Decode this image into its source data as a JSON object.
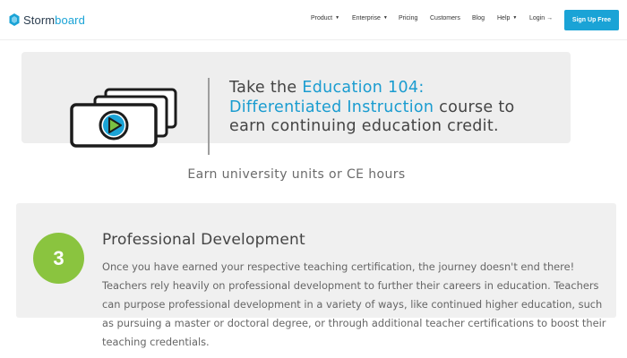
{
  "header": {
    "logo_prefix": "Storm",
    "logo_suffix": "board",
    "nav": [
      {
        "label": "Product",
        "dropdown": true
      },
      {
        "label": "Enterprise",
        "dropdown": true
      },
      {
        "label": "Pricing",
        "dropdown": false
      },
      {
        "label": "Customers",
        "dropdown": false
      },
      {
        "label": "Blog",
        "dropdown": false
      },
      {
        "label": "Help",
        "dropdown": true
      },
      {
        "label": "Login →",
        "dropdown": false
      }
    ],
    "signup_label": "Sign Up Free"
  },
  "promo": {
    "text_before": "Take the ",
    "course_name": "Education 104: Differentiated Instruction",
    "text_after": " course to earn continuing education credit.",
    "icon": "video-play-icon"
  },
  "earn_text": "Earn university units or CE hours",
  "step": {
    "number": "3",
    "title": "Professional Development",
    "body": "Once you have earned your respective teaching certification, the journey doesn't end there! Teachers rely heavily on professional development to further their careers in education. Teachers can purpose professional development in a variety of ways, like continued higher education, such as pursuing a master or doctoral degree, or through additional teacher certifications to boost their teaching credentials."
  },
  "colors": {
    "accent": "#1aa3d6",
    "step_circle": "#8ac43f",
    "card_bg": "#eeeeee"
  }
}
